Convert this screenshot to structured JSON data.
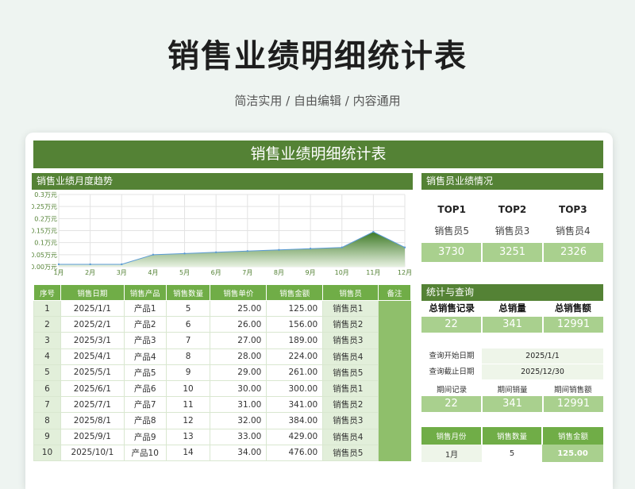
{
  "page": {
    "title": "销售业绩明细统计表",
    "subtitle": "简洁实用 / 自由编辑 / 内容通用"
  },
  "sheet": {
    "title": "销售业绩明细统计表",
    "trend_header": "销售业绩月度趋势",
    "ranking_header": "销售员业绩情况",
    "stats_header": "统计与查询"
  },
  "chart_data": {
    "type": "area",
    "categories": [
      "1月",
      "2月",
      "3月",
      "4月",
      "5月",
      "6月",
      "7月",
      "8月",
      "9月",
      "10月",
      "11月",
      "12月"
    ],
    "values": [
      0.01,
      0.01,
      0.01,
      0.05,
      0.055,
      0.06,
      0.065,
      0.07,
      0.075,
      0.08,
      0.145,
      0.08
    ],
    "yticks": [
      "0.00万元",
      "0.05万元",
      "0.1万元",
      "0.15万元",
      "0.2万元",
      "0.25万元",
      "0.3万元"
    ],
    "ylim": [
      0,
      0.3
    ],
    "grid": true,
    "colors": {
      "fill_top": "#3d7a25",
      "fill_bottom": "#e7f1e1",
      "line": "#5b9bd5"
    }
  },
  "table": {
    "headers": [
      "序号",
      "销售日期",
      "销售产品",
      "销售数量",
      "销售单价",
      "销售金额",
      "销售员",
      "备注"
    ],
    "rows": [
      [
        "1",
        "2025/1/1",
        "产品1",
        "5",
        "25.00",
        "125.00",
        "销售员1",
        ""
      ],
      [
        "2",
        "2025/2/1",
        "产品2",
        "6",
        "26.00",
        "156.00",
        "销售员2",
        ""
      ],
      [
        "3",
        "2025/3/1",
        "产品3",
        "7",
        "27.00",
        "189.00",
        "销售员3",
        ""
      ],
      [
        "4",
        "2025/4/1",
        "产品4",
        "8",
        "28.00",
        "224.00",
        "销售员4",
        ""
      ],
      [
        "5",
        "2025/5/1",
        "产品5",
        "9",
        "29.00",
        "261.00",
        "销售员5",
        ""
      ],
      [
        "6",
        "2025/6/1",
        "产品6",
        "10",
        "30.00",
        "300.00",
        "销售员1",
        ""
      ],
      [
        "7",
        "2025/7/1",
        "产品7",
        "11",
        "31.00",
        "341.00",
        "销售员2",
        ""
      ],
      [
        "8",
        "2025/8/1",
        "产品8",
        "12",
        "32.00",
        "384.00",
        "销售员3",
        ""
      ],
      [
        "9",
        "2025/9/1",
        "产品9",
        "13",
        "33.00",
        "429.00",
        "销售员4",
        ""
      ],
      [
        "10",
        "2025/10/1",
        "产品10",
        "14",
        "34.00",
        "476.00",
        "销售员5",
        ""
      ]
    ]
  },
  "ranking": {
    "labels": [
      "TOP1",
      "TOP2",
      "TOP3"
    ],
    "names": [
      "销售员5",
      "销售员3",
      "销售员4"
    ],
    "values": [
      "3730",
      "3251",
      "2326"
    ]
  },
  "stats": {
    "headers": [
      "总销售记录",
      "总销量",
      "总销售额"
    ],
    "values": [
      "22",
      "341",
      "12991"
    ]
  },
  "query": {
    "start_label": "查询开始日期",
    "start_value": "2025/1/1",
    "end_label": "查询截止日期",
    "end_value": "2025/12/30",
    "period_labels": [
      "期间记录",
      "期间销量",
      "期间销售额"
    ],
    "period_values": [
      "22",
      "341",
      "12991"
    ]
  },
  "monthly": {
    "headers": [
      "销售月份",
      "销售数量",
      "销售金额"
    ],
    "rows": [
      [
        "1月",
        "5",
        "125.00"
      ]
    ]
  }
}
